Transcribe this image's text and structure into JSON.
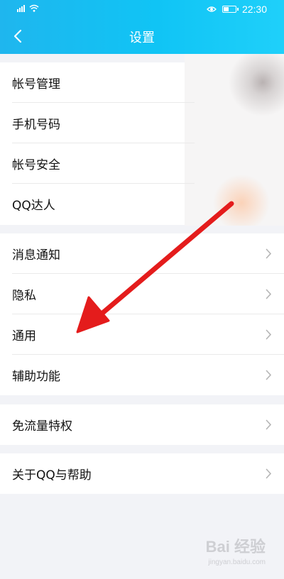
{
  "status_bar": {
    "time": "22:30"
  },
  "header": {
    "title": "设置"
  },
  "groups": [
    {
      "items": [
        {
          "label": "帐号管理"
        },
        {
          "label": "手机号码"
        },
        {
          "label": "帐号安全"
        },
        {
          "label": "QQ达人"
        }
      ]
    },
    {
      "items": [
        {
          "label": "消息通知"
        },
        {
          "label": "隐私"
        },
        {
          "label": "通用"
        },
        {
          "label": "辅助功能"
        }
      ]
    },
    {
      "items": [
        {
          "label": "免流量特权"
        }
      ]
    },
    {
      "items": [
        {
          "label": "关于QQ与帮助"
        }
      ]
    }
  ],
  "annotation": {
    "arrow_color": "#e41c1c",
    "points_to": "通用"
  },
  "watermark": {
    "text": "Bai 经验",
    "sub": "jingyan.baidu.com"
  },
  "colors": {
    "header_start": "#1fb6ee",
    "header_end": "#1fd0fa",
    "background": "#f2f3f7"
  }
}
